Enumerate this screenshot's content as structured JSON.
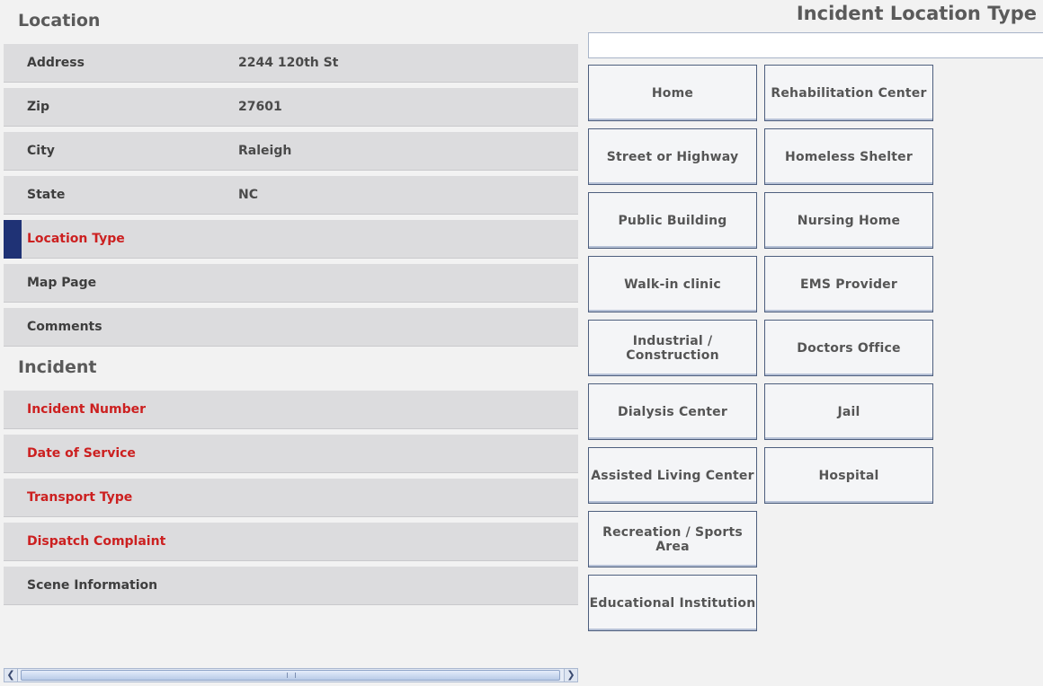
{
  "location": {
    "title": "Location",
    "rows": [
      {
        "label": "Address",
        "value": "2244 120th St"
      },
      {
        "label": "Zip",
        "value": "27601"
      },
      {
        "label": "City",
        "value": "Raleigh"
      },
      {
        "label": "State",
        "value": "NC"
      },
      {
        "label": "Location Type",
        "value": ""
      },
      {
        "label": "Map Page",
        "value": ""
      },
      {
        "label": "Comments",
        "value": ""
      }
    ]
  },
  "incident": {
    "title": "Incident",
    "rows": [
      {
        "label": "Incident Number"
      },
      {
        "label": "Date of Service"
      },
      {
        "label": "Transport Type"
      },
      {
        "label": "Dispatch Complaint"
      },
      {
        "label": "Scene Information"
      }
    ]
  },
  "panel": {
    "title": "Incident Location Type",
    "search_value": "",
    "options": [
      "Home",
      "Rehabilitation Center",
      "Street or Highway",
      "Homeless Shelter",
      "Public Building",
      "Nursing Home",
      "Walk-in clinic",
      "EMS Provider",
      "Industrial / Construction",
      "Doctors Office",
      "Dialysis Center",
      "Jail",
      "Assisted Living Center",
      "Hospital",
      "Recreation / Sports Area",
      "Educational Institution"
    ]
  },
  "colors": {
    "required_label": "#cc2020",
    "selected_marker": "#1f3275"
  }
}
